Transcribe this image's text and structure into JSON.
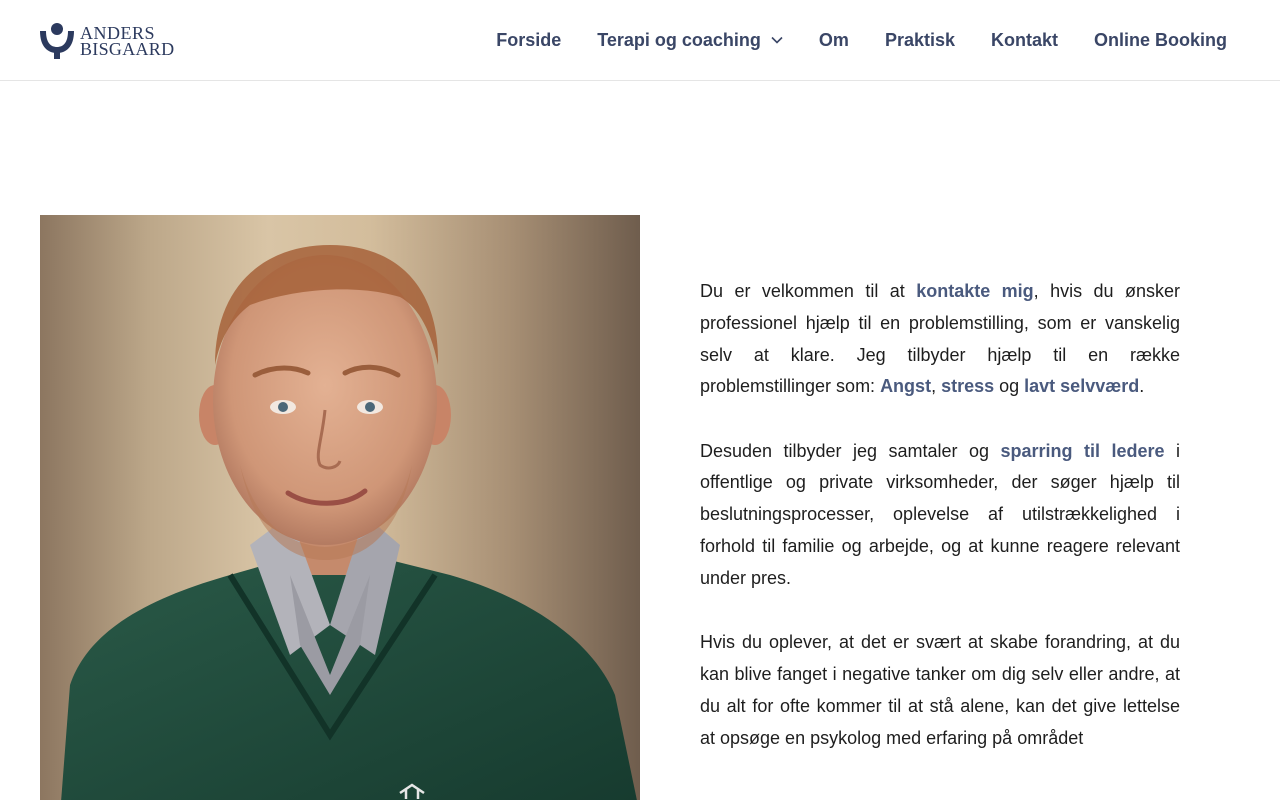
{
  "brand": {
    "line1": "ANDERS",
    "line2": "BISGAARD",
    "logo_icon": "person-arms-icon",
    "color": "#2c3a5e"
  },
  "nav": {
    "items": [
      {
        "label": "Forside"
      },
      {
        "label": "Terapi og coaching",
        "icon": "chevron-down-icon"
      },
      {
        "label": "Om"
      },
      {
        "label": "Praktisk"
      },
      {
        "label": "Kontakt"
      },
      {
        "label": "Online Booking"
      }
    ],
    "color": "#3a4666"
  },
  "photo": {
    "subject": "portrait-photo",
    "colors": {
      "sweater": "#1f4a3a",
      "shirt": "#a8a8ae",
      "skin": "#d9a282",
      "hair": "#9a5a34"
    }
  },
  "content": {
    "link_color": "#4a5a7e",
    "p1": {
      "t1": "Du er velkommen til at ",
      "link1": "kontakte mig",
      "t2": ", hvis du ønsker professionel hjælp til en problemstilling, som er vanskelig selv at klare. Jeg tilbyder hjælp til en række problemstillinger som: ",
      "link2": "Angst",
      "t3": ", ",
      "link3": "stress",
      "t4": " og ",
      "link4": "lavt selvværd",
      "t5": "."
    },
    "p2": {
      "t1": "Desuden tilbyder jeg samtaler og ",
      "link1": "sparring til ledere",
      "t2": " i offentlige og private virksomheder, der søger hjælp til beslutningsprocesser, oplevelse af utilstrækkelighed i forhold til familie og arbejde, og at kunne reagere relevant under pres."
    },
    "p3": {
      "t1": "Hvis du oplever, at det er svært at skabe forandring, at du kan blive fanget i negative tanker om dig selv eller andre, at du alt for ofte kommer til at stå alene, kan det give lettelse at opsøge en psykolog med erfaring på området"
    }
  }
}
